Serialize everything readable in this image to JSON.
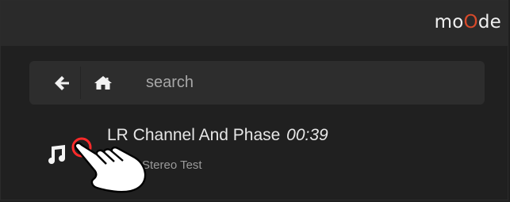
{
  "header": {
    "logo": {
      "part1": "mo",
      "part2": "O",
      "part3": "de"
    }
  },
  "search": {
    "placeholder": "search"
  },
  "track": {
    "title": "LR Channel And Phase",
    "duration": "00:39",
    "subtitle": "Stereo Test"
  },
  "colors": {
    "accent": "#d84a2a",
    "background": "#202020",
    "topbar": "#2a2a2a"
  },
  "icons": {
    "back": "back-arrow-icon",
    "home": "home-icon",
    "track": "music-note-icon",
    "cursor": "pointing-hand-cursor"
  }
}
